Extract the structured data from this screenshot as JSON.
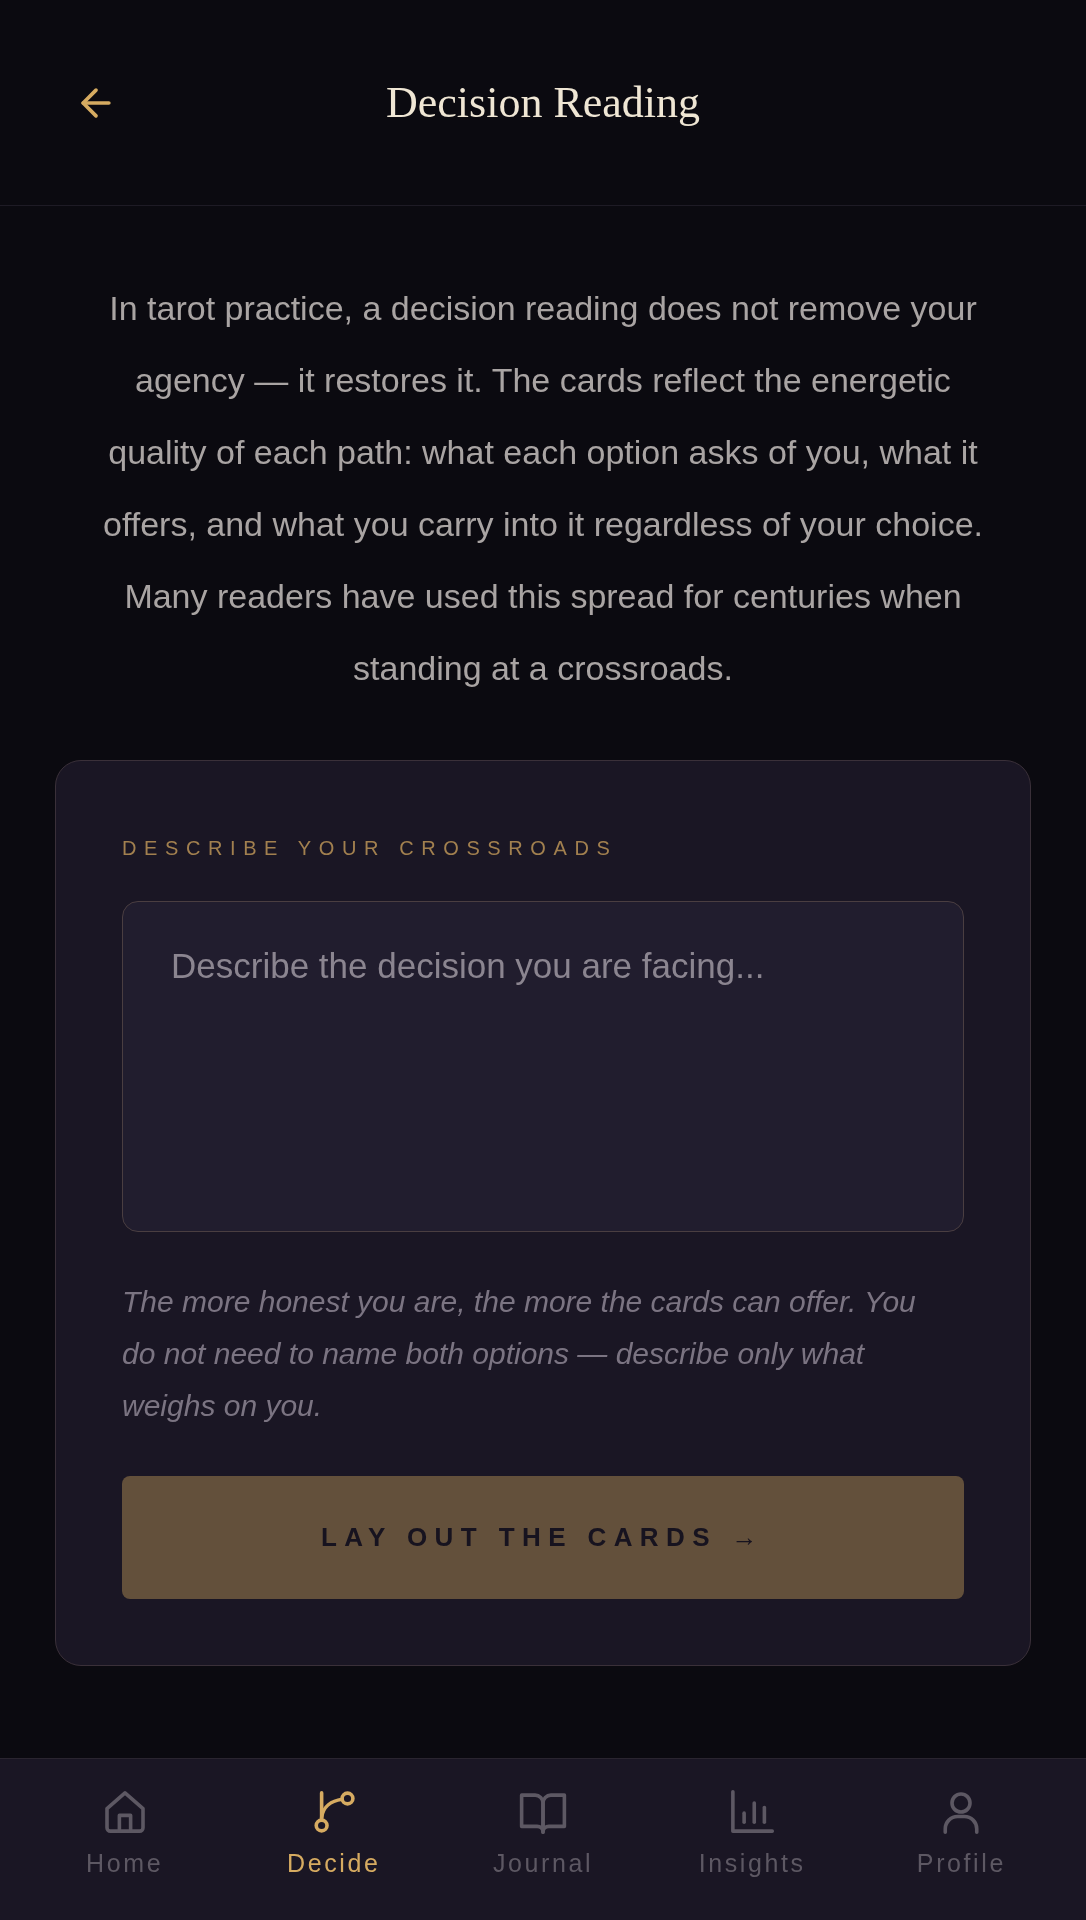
{
  "header": {
    "title": "Decision Reading"
  },
  "intro": "In tarot practice, a decision reading does not remove your agency — it restores it. The cards reflect the energetic quality of each path: what each option asks of you, what it offers, and what you carry into it regardless of your choice. Many readers have used this spread for centuries when standing at a crossroads.",
  "form": {
    "label": "DESCRIBE YOUR CROSSROADS",
    "placeholder": "Describe the decision you are facing...",
    "hint": "The more honest you are, the more the cards can offer. You do not need to name both options — describe only what weighs on you.",
    "button": "LAY OUT THE CARDS →"
  },
  "nav": [
    {
      "kind": "home",
      "label": "Home",
      "selected": false
    },
    {
      "kind": "decide",
      "label": "Decide",
      "selected": true
    },
    {
      "kind": "journal",
      "label": "Journal",
      "selected": false
    },
    {
      "kind": "insights",
      "label": "Insights",
      "selected": false
    },
    {
      "kind": "profile",
      "label": "Profile",
      "selected": false
    }
  ]
}
